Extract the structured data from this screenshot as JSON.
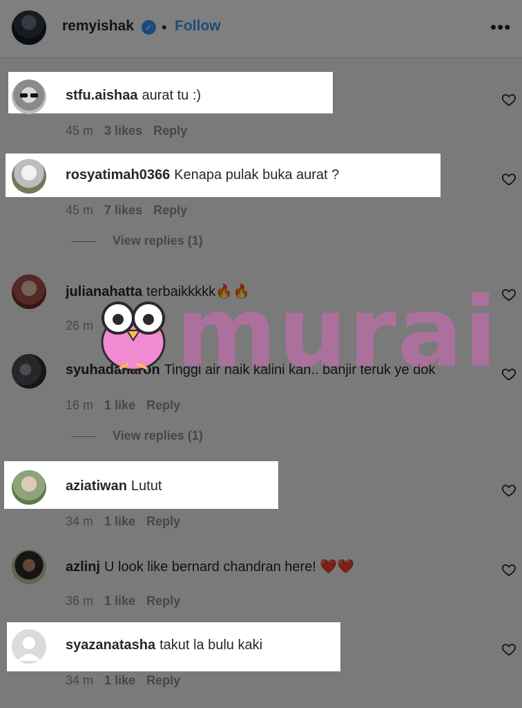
{
  "header": {
    "username": "remyishak",
    "verified_icon": "verified-badge-icon",
    "separator": "•",
    "follow_label": "Follow",
    "more_icon": "more-options-icon"
  },
  "comments": [
    {
      "username": "stfu.aishaa",
      "text": "aurat tu :)",
      "time": "45 m",
      "likes": "3 likes",
      "reply": "Reply",
      "highlighted": true
    },
    {
      "username": "rosyatimah0366",
      "text": "Kenapa pulak buka aurat ?",
      "time": "45 m",
      "likes": "7 likes",
      "reply": "Reply",
      "highlighted": true,
      "view_replies": "View replies (1)"
    },
    {
      "username": "julianahatta",
      "text": "terbaikkkkk🔥🔥",
      "time": "26 m",
      "likes": "",
      "reply": "",
      "highlighted": false
    },
    {
      "username": "syuhadaharon",
      "text": "Tinggi air naik kalini kan.. banjir teruk ye dok",
      "time": "16 m",
      "likes": "1 like",
      "reply": "Reply",
      "highlighted": false,
      "view_replies": "View replies (1)"
    },
    {
      "username": "aziatiwan",
      "text": "Lutut",
      "time": "34 m",
      "likes": "1 like",
      "reply": "Reply",
      "highlighted": true
    },
    {
      "username": "azlinj",
      "text": "U look like bernard chandran here! ❤️❤️",
      "time": "36 m",
      "likes": "1 like",
      "reply": "Reply",
      "highlighted": false
    },
    {
      "username": "syazanatasha",
      "text": "takut la bulu kaki",
      "time": "34 m",
      "likes": "1 like",
      "reply": "Reply",
      "highlighted": true
    }
  ],
  "watermark": {
    "text": "murai",
    "color": "#d667ba"
  },
  "colors": {
    "follow": "#3f97f6",
    "meta": "#8e8e8e",
    "verified": "#3797f0"
  }
}
